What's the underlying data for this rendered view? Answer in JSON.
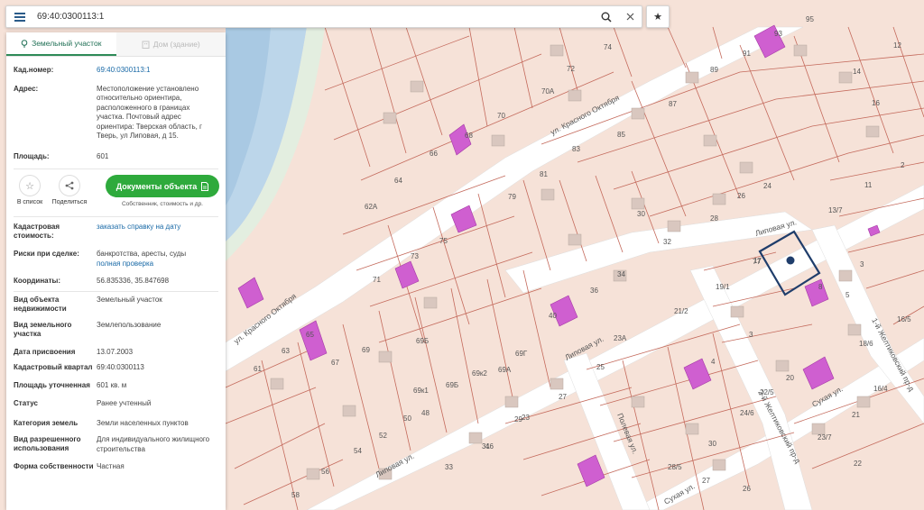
{
  "search": {
    "value": "69:40:0300113:1"
  },
  "tabs": [
    {
      "label": "Земельный участок",
      "icon": "pin-icon",
      "active": true
    },
    {
      "label": "Дом (здание)",
      "icon": "building-icon",
      "active": false
    }
  ],
  "info": {
    "cad_number": {
      "label": "Кад.номер:",
      "value": "69:40:0300113:1"
    },
    "address": {
      "label": "Адрес:",
      "value": "Местоположение установлено относительно ориентира, расположенного в границах участка. Почтовый адрес ориентира: Тверская область, г Тверь, ул Липовая, д 15."
    },
    "area": {
      "label": "Площадь:",
      "value": "601"
    }
  },
  "actions": {
    "favorite": "В список",
    "share": "Поделиться",
    "docs_button": "Документы объекта",
    "docs_sub": "Собственник, стоимость и др."
  },
  "details": {
    "cad_cost": {
      "label": "Кадастровая стоимость:",
      "value": "заказать справку на дату"
    },
    "risks": {
      "label": "Риски при сделке:",
      "value": "банкротства, аресты, суды",
      "link": "полная проверка"
    },
    "coords": {
      "label": "Координаты:",
      "value": "56.835336, 35.847698"
    },
    "object_type": {
      "label": "Вид объекта недвижимости",
      "value": "Земельный участок"
    },
    "land_type": {
      "label": "Вид земельного участка",
      "value": "Землепользование"
    },
    "assign_date": {
      "label": "Дата присвоения",
      "value": "13.07.2003"
    },
    "quarter": {
      "label": "Кадастровый квартал",
      "value": "69:40:0300113"
    },
    "precise_area": {
      "label": "Площадь уточненная",
      "value": "601 кв. м"
    },
    "status": {
      "label": "Статус",
      "value": "Ранее учтенный"
    },
    "category": {
      "label": "Категория земель",
      "value": "Земли населенных пунктов"
    },
    "permitted_use": {
      "label": "Вид разрешенного использования",
      "value": "Для индивидуального жилищного строительства"
    },
    "ownership": {
      "label": "Форма собственности",
      "value": "Частная"
    }
  },
  "map": {
    "streets": [
      "ул. Красного Октября",
      "ул. Красного Октября",
      "Липовая ул.",
      "Липовая ул.",
      "Липовая ул.",
      "Сухая ул.",
      "Сухая ул.",
      "Полевая ул.",
      "2-й Желтиковский пр-д",
      "1-й Желтиковский пр-д"
    ],
    "parcel_labels": [
      "95",
      "93",
      "91",
      "89",
      "87",
      "74",
      "72",
      "70А",
      "70",
      "68",
      "66",
      "64",
      "62А",
      "85",
      "83",
      "81",
      "79",
      "75",
      "73",
      "71",
      "77",
      "14",
      "12",
      "16",
      "2",
      "11",
      "13/7",
      "3",
      "5",
      "17",
      "19/1",
      "30",
      "32",
      "34",
      "36",
      "28",
      "26",
      "24",
      "40",
      "21/2",
      "23А",
      "25",
      "27",
      "29",
      "31",
      "33",
      "3",
      "8",
      "4",
      "24/6",
      "22/5",
      "20",
      "16/5",
      "18/6",
      "16/4",
      "21",
      "23/7",
      "22",
      "28/5",
      "30",
      "27",
      "26",
      "61",
      "63",
      "65",
      "67",
      "69",
      "69Б",
      "69Б",
      "69А",
      "69Г",
      "69к2",
      "69к1",
      "58",
      "56",
      "54",
      "52",
      "50",
      "48",
      "46",
      "23",
      "25"
    ],
    "colors": {
      "parcel_fill": "#f6e2d8",
      "parcel_line": "#c46a5c",
      "building": "#cf5fd0",
      "street": "#ffffff",
      "water": "#bcd6ea",
      "selected": "#1f3d6b"
    }
  }
}
